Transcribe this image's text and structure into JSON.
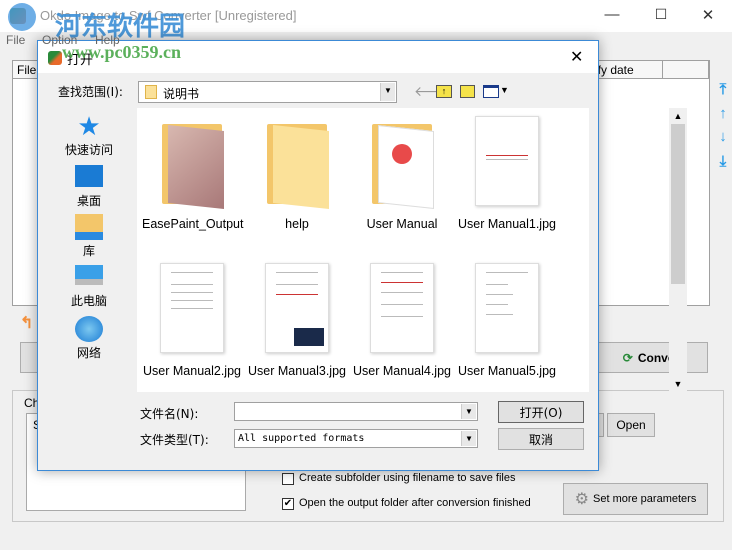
{
  "app": {
    "title": "Okdo Image to Swf Converter [Unregistered]",
    "menu": [
      "File",
      "Option",
      "Help"
    ],
    "watermark": {
      "name": "河东软件园",
      "url": "www.pc0359.cn"
    },
    "table": {
      "columns": [
        "File",
        "ify date",
        ""
      ]
    },
    "convert_label": "Convert",
    "group_label": "Ch",
    "list_first": "S",
    "open_label": "Open",
    "create_subfolder": {
      "label": "Create subfolder using filename to save files",
      "checked": false
    },
    "open_output": {
      "label": "Open the output folder after conversion finished",
      "checked": true
    },
    "set_params_label": "Set more parameters"
  },
  "dialog": {
    "title": "打开",
    "look_in_label": "查找范围(I):",
    "look_in_value": "说明书",
    "places": [
      "快速访问",
      "桌面",
      "库",
      "此电脑",
      "网络"
    ],
    "files": [
      {
        "name": "EasePaint_Output",
        "type": "folder-image"
      },
      {
        "name": "help",
        "type": "folder"
      },
      {
        "name": "User Manual",
        "type": "folder-pdf"
      },
      {
        "name": "User Manual1.jpg",
        "type": "doc"
      },
      {
        "name": "User Manual2.jpg",
        "type": "doc"
      },
      {
        "name": "User Manual3.jpg",
        "type": "doc"
      },
      {
        "name": "User Manual4.jpg",
        "type": "doc"
      },
      {
        "name": "User Manual5.jpg",
        "type": "doc"
      }
    ],
    "filename_label": "文件名(N):",
    "filename_value": "",
    "filetype_label": "文件类型(T):",
    "filetype_value": "All supported formats",
    "open_button": "打开(O)",
    "cancel_button": "取消"
  }
}
